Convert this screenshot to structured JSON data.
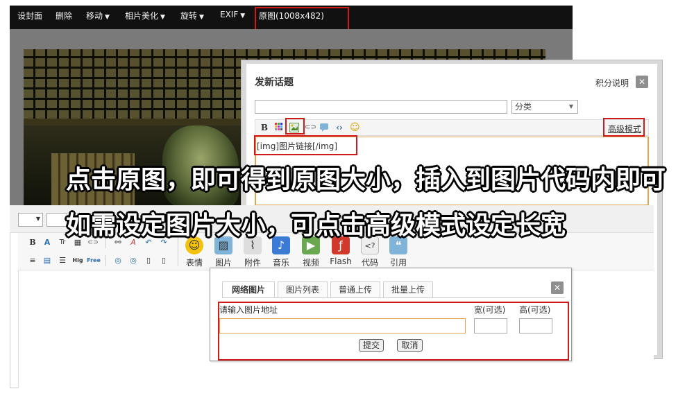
{
  "topbar": {
    "items": [
      {
        "label": "设封面",
        "caret": ""
      },
      {
        "label": "删除",
        "caret": ""
      },
      {
        "label": "移动",
        "caret": "▼"
      },
      {
        "label": "相片美化",
        "caret": "▼"
      },
      {
        "label": "旋转",
        "caret": "▼"
      },
      {
        "label": "EXIF",
        "caret": "▼"
      },
      {
        "label": "原图(1008x482)",
        "caret": ""
      }
    ]
  },
  "post_dialog": {
    "title": "发新话题",
    "credits_link": "积分说明",
    "close_icon": "✕",
    "category_value": "分类",
    "category_caret": "▼",
    "advanced_mode": "高级模式",
    "toolbar": {
      "bold": "B",
      "color_icon": "color-grid-icon",
      "image_icon": "image-icon",
      "link_icon": "link-icon",
      "quote_icon": "quote-icon",
      "code_icon": "code-icon",
      "emoji_icon": "smiley-icon",
      "link_glyph": "⊂⊃",
      "code_glyph": "‹›",
      "smile_glyph": "☺"
    },
    "code_text": "[img]图片链接[/img]"
  },
  "overlay": {
    "line1": "点击原图，即可得到原图大小，插入到图片代码内即可",
    "line2": "如需设定图片大小，可点击高级模式设定长宽"
  },
  "editor": {
    "doc_caret": "▼",
    "small_tools_row1": [
      "B",
      "A",
      "Tr",
      "▦",
      "⊂⊃",
      "⚯",
      "A",
      "↶",
      "↷"
    ],
    "small_tools_row2": [
      "≡",
      "▤",
      "☰",
      "Hig",
      "Free",
      "◎",
      "◎",
      "▯",
      "▯"
    ],
    "big_tools": [
      {
        "label": "表情",
        "icon": "☺",
        "color": "#f4c20d"
      },
      {
        "label": "图片",
        "icon": "▨",
        "color": "#7fb3d8"
      },
      {
        "label": "附件",
        "icon": "⌇",
        "color": "#dddddd"
      },
      {
        "label": "音乐",
        "icon": "♪",
        "color": "#3b7bd6"
      },
      {
        "label": "视频",
        "icon": "▶",
        "color": "#6aa84f"
      },
      {
        "label": "Flash",
        "icon": "ƒ",
        "color": "#d0392b"
      },
      {
        "label": "代码",
        "icon": "<?",
        "color": "#eeeeee"
      },
      {
        "label": "引用",
        "icon": "❝",
        "color": "#7fb3d8"
      }
    ]
  },
  "image_popup": {
    "tabs": [
      "网络图片",
      "图片列表",
      "普通上传",
      "批量上传"
    ],
    "active_tab": 0,
    "url_label": "请输入图片地址",
    "width_label": "宽(可选)",
    "height_label": "高(可选)",
    "url_value": "",
    "width_value": "",
    "height_value": "",
    "submit_label": "提交",
    "cancel_label": "取消",
    "close_icon": "✕"
  },
  "colors": {
    "highlight": "#d01a1a",
    "input_focus": "#e1a44a",
    "topbar_bg": "#111111"
  }
}
